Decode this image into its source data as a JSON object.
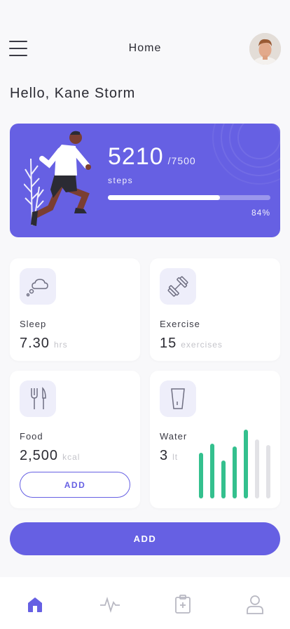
{
  "header": {
    "title": "Home"
  },
  "greeting": "Hello, Kane Storm",
  "steps": {
    "value": "5210",
    "goal": "/7500",
    "label": "steps",
    "percent_text": "84%",
    "progress": 0.69
  },
  "cards": {
    "sleep": {
      "label": "Sleep",
      "value": "7.30",
      "unit": "hrs",
      "icon": "sleep-cloud-icon"
    },
    "exercise": {
      "label": "Exercise",
      "value": "15",
      "unit": "exercises",
      "icon": "dumbbell-icon"
    },
    "food": {
      "label": "Food",
      "value": "2,500",
      "unit": "kcal",
      "icon": "fork-knife-icon",
      "button_label": "ADD"
    },
    "water": {
      "label": "Water",
      "value": "3",
      "unit": "lt",
      "icon": "glass-icon",
      "bars": [
        {
          "level": 0.66,
          "filled": true
        },
        {
          "level": 0.8,
          "filled": true
        },
        {
          "level": 0.55,
          "filled": true
        },
        {
          "level": 0.76,
          "filled": true
        },
        {
          "level": 1.0,
          "filled": true
        },
        {
          "level": 0.86,
          "filled": false
        },
        {
          "level": 0.78,
          "filled": false
        }
      ]
    }
  },
  "add_button_label": "ADD",
  "tabs": [
    {
      "name": "home",
      "icon": "home-icon",
      "active": true
    },
    {
      "name": "activity",
      "icon": "activity-pulse-icon",
      "active": false
    },
    {
      "name": "health",
      "icon": "clipboard-plus-icon",
      "active": false
    },
    {
      "name": "profile",
      "icon": "user-icon",
      "active": false
    }
  ],
  "colors": {
    "accent": "#6660e3",
    "water_bar": "#34c08e",
    "water_bar_empty": "#e2e2e6",
    "icon_muted": "#6f6f82"
  }
}
